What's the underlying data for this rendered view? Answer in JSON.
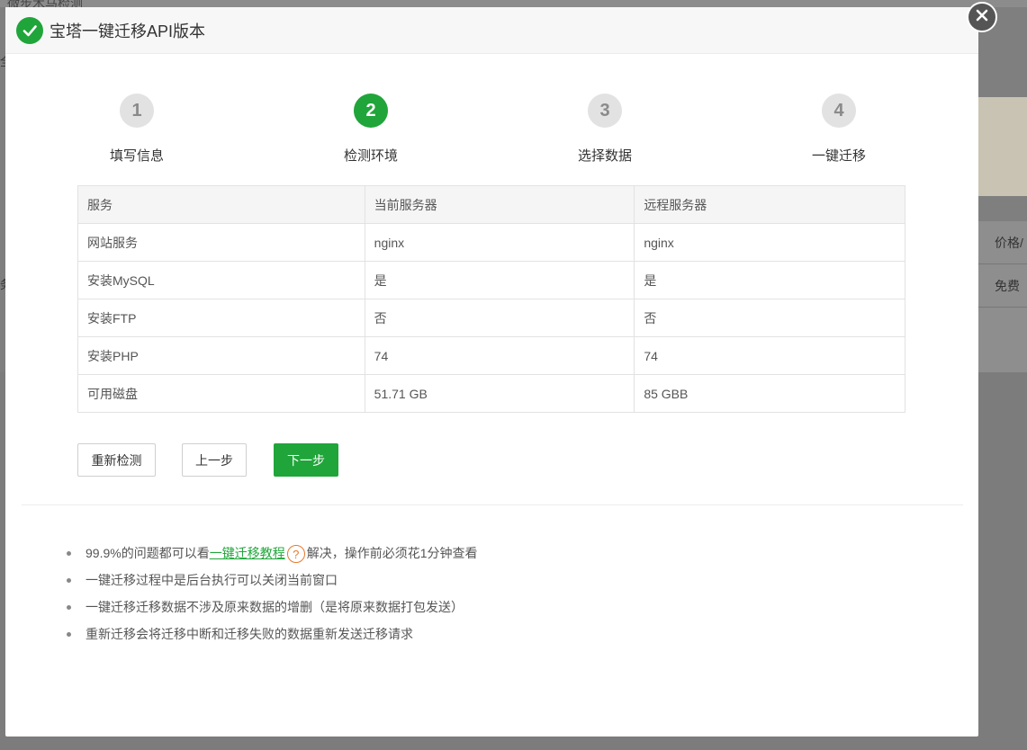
{
  "background": {
    "title_fragment": "微步木马检测",
    "right_header": "价格/",
    "right_cell": "免费",
    "left_frag_1": "全",
    "left_frag_2": "务"
  },
  "modal": {
    "title": "宝塔一键迁移API版本",
    "close_label": "×"
  },
  "steps": [
    {
      "number": "1",
      "label": "填写信息",
      "active": false
    },
    {
      "number": "2",
      "label": "检测环境",
      "active": true
    },
    {
      "number": "3",
      "label": "选择数据",
      "active": false
    },
    {
      "number": "4",
      "label": "一键迁移",
      "active": false
    }
  ],
  "table": {
    "headers": [
      "服务",
      "当前服务器",
      "远程服务器"
    ],
    "rows": [
      [
        "网站服务",
        "nginx",
        "nginx"
      ],
      [
        "安装MySQL",
        "是",
        "是"
      ],
      [
        "安装FTP",
        "否",
        "否"
      ],
      [
        "安装PHP",
        "74",
        "74"
      ],
      [
        "可用磁盘",
        "51.71 GB",
        "85 GBB"
      ]
    ]
  },
  "buttons": {
    "recheck": "重新检测",
    "prev": "上一步",
    "next": "下一步"
  },
  "tips": {
    "tip1_prefix": "99.9%的问题都可以看",
    "tip1_link": "一键迁移教程",
    "tip1_suffix": "解决，操作前必须花1分钟查看",
    "tip2": "一键迁移过程中是后台执行可以关闭当前窗口",
    "tip3": "一键迁移迁移数据不涉及原来数据的增删（是将原来数据打包发送）",
    "tip4": "重新迁移会将迁移中断和迁移失败的数据重新发送迁移请求"
  },
  "colors": {
    "accent": "#20a53a",
    "help_icon": "#e8792e"
  }
}
